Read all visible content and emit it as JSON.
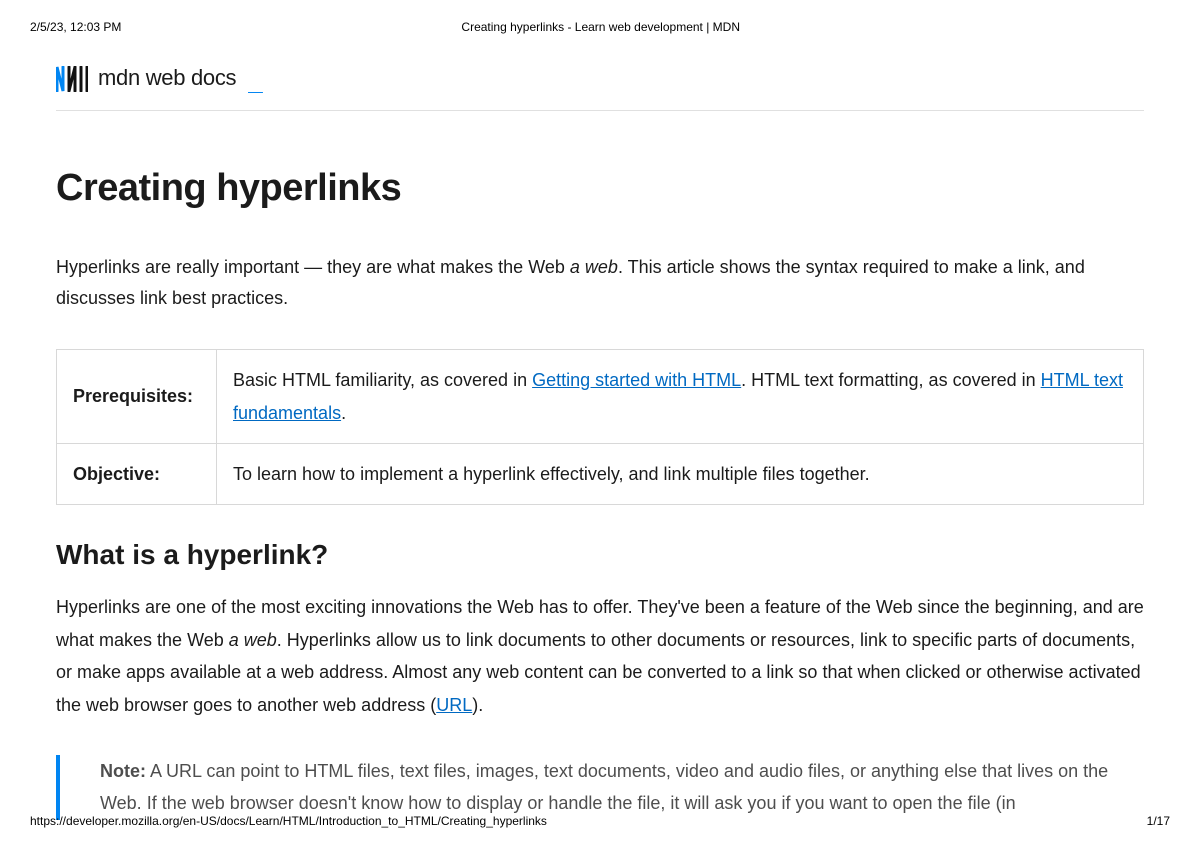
{
  "print": {
    "timestamp": "2/5/23, 12:03 PM",
    "doc_title": "Creating hyperlinks - Learn web development | MDN",
    "url": "https://developer.mozilla.org/en-US/docs/Learn/HTML/Introduction_to_HTML/Creating_hyperlinks",
    "page_indicator": "1/17"
  },
  "brand": {
    "name": "mdn web docs",
    "underscore": "_"
  },
  "page": {
    "title": "Creating hyperlinks",
    "intro_a": "Hyperlinks are really important — they are what makes the Web ",
    "intro_em": "a web",
    "intro_b": ". This article shows the syntax required to make a link, and discusses link best practices."
  },
  "meta_table": {
    "row1_label": "Prerequisites:",
    "row1_text_a": "Basic HTML familiarity, as covered in ",
    "row1_link1": "Getting started with HTML",
    "row1_text_b": ". HTML text formatting, as covered in ",
    "row1_link2": "HTML text fundamentals",
    "row1_text_c": ".",
    "row2_label": "Objective:",
    "row2_text": "To learn how to implement a hyperlink effectively, and link multiple files together."
  },
  "section1": {
    "heading": "What is a hyperlink?",
    "p1_a": "Hyperlinks are one of the most exciting innovations the Web has to offer. They've been a feature of the Web since the beginning, and are what makes the Web ",
    "p1_em": "a web",
    "p1_b": ". Hyperlinks allow us to link documents to other documents or resources, link to specific parts of documents, or make apps available at a web address. Almost any web content can be converted to a link so that when clicked or otherwise activated the web browser goes to another web address (",
    "p1_link": "URL",
    "p1_c": ")."
  },
  "note": {
    "label": "Note:",
    "text": " A URL can point to HTML files, text files, images, text documents, video and audio files, or anything else that lives on the Web. If the web browser doesn't know how to display or handle the file, it will ask you if you want to open the file (in"
  }
}
